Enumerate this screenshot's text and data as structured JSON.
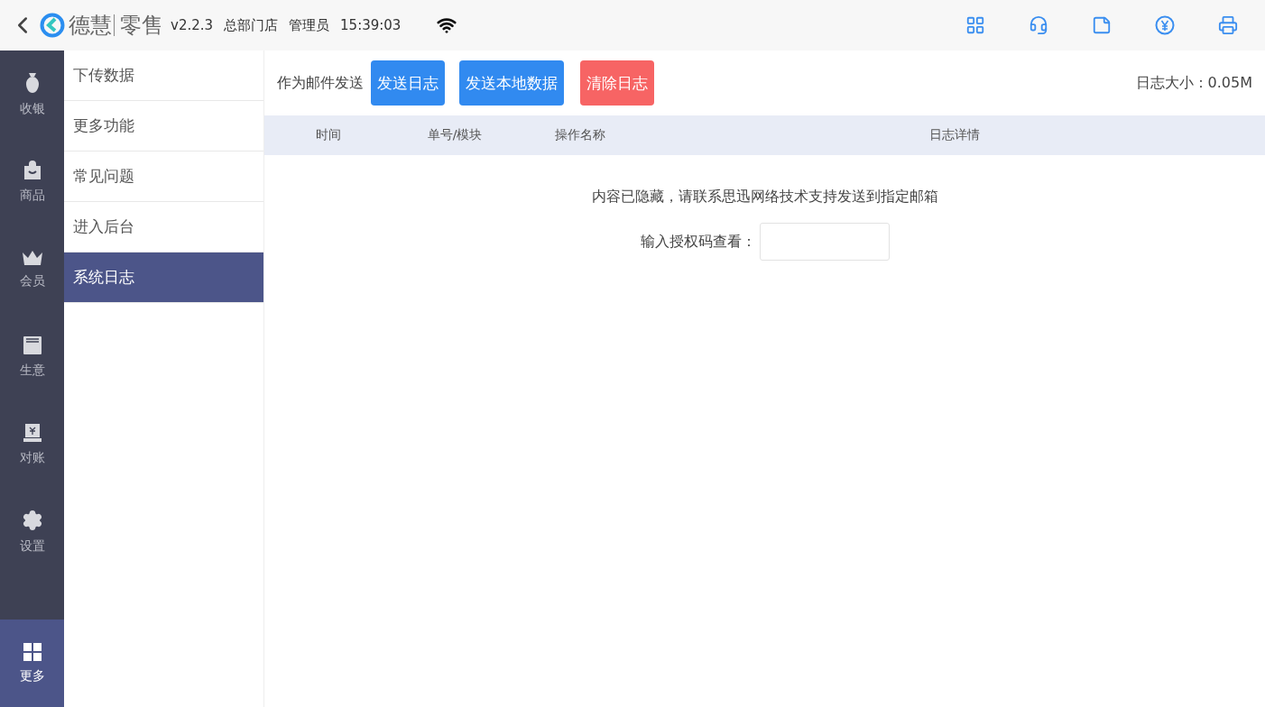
{
  "header": {
    "brand": "德慧",
    "product": "零售",
    "version": "v2.2.3",
    "store": "总部门店",
    "user": "管理员",
    "time": "15:39:03"
  },
  "nav": [
    {
      "kind": "cash",
      "label": "收银",
      "selected": false
    },
    {
      "kind": "goods",
      "label": "商品",
      "selected": false
    },
    {
      "kind": "member",
      "label": "会员",
      "selected": false
    },
    {
      "kind": "business",
      "label": "生意",
      "selected": false
    },
    {
      "kind": "reconcile",
      "label": "对账",
      "selected": false
    },
    {
      "kind": "settings",
      "label": "设置",
      "selected": false
    },
    {
      "kind": "more",
      "label": "更多",
      "selected": true
    }
  ],
  "submenu": [
    {
      "label": "下传数据",
      "selected": false
    },
    {
      "label": "更多功能",
      "selected": false
    },
    {
      "label": "常见问题",
      "selected": false
    },
    {
      "label": "进入后台",
      "selected": false
    },
    {
      "label": "系统日志",
      "selected": true
    }
  ],
  "toolbar": {
    "label": "作为邮件发送",
    "buttons": [
      {
        "label": "发送日志",
        "kind": "primary"
      },
      {
        "label": "发送本地数据",
        "kind": "primary"
      },
      {
        "label": "清除日志",
        "kind": "danger"
      }
    ],
    "log_size": "日志大小：0.05M"
  },
  "table": {
    "columns": [
      "时间",
      "单号/模块",
      "操作名称",
      "日志详情"
    ]
  },
  "notice": "内容已隐藏，请联系思迅网络技术支持发送到指定邮箱",
  "auth": {
    "label": "输入授权码查看："
  }
}
